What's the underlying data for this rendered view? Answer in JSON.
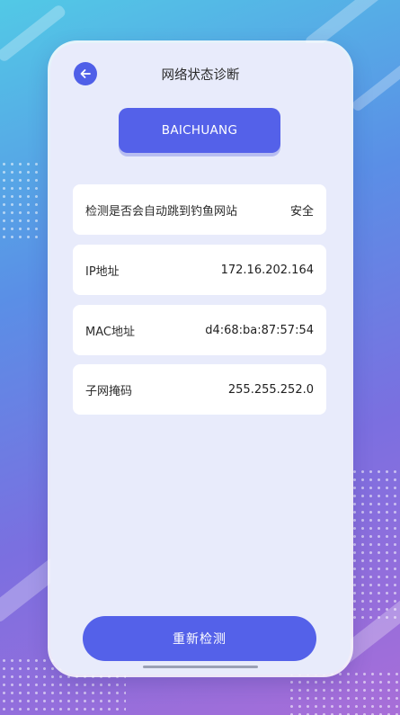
{
  "header": {
    "title": "网络状态诊断"
  },
  "network_name": "BAICHUANG",
  "rows": [
    {
      "label": "检测是否会自动跳到钓鱼网站",
      "value": "安全"
    },
    {
      "label": "IP地址",
      "value": "172.16.202.164"
    },
    {
      "label": "MAC地址",
      "value": "d4:68:ba:87:57:54"
    },
    {
      "label": "子网掩码",
      "value": "255.255.252.0"
    }
  ],
  "actions": {
    "recheck_label": "重新检测"
  },
  "colors": {
    "accent": "#5461e9",
    "panel_bg": "#e8ebfb",
    "card_bg": "#ffffff"
  }
}
